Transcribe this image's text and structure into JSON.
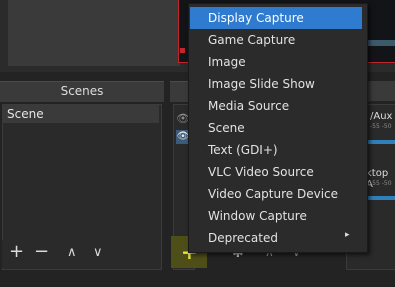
{
  "scenes": {
    "title": "Scenes",
    "items": [
      "Scene"
    ],
    "toolbar": {
      "add": "+",
      "remove": "−",
      "up": "∧",
      "down": "∨"
    }
  },
  "sources": {
    "toolbar": {
      "add": "+",
      "settings": "✱",
      "up": "∧",
      "down": "∨"
    },
    "visibility_icon": "eye-icon"
  },
  "mixer": {
    "channels": [
      {
        "label": "/Aux",
        "scale": "-55  -50"
      },
      {
        "label": "ktop A",
        "scale": "-55  -50"
      }
    ]
  },
  "context_menu": {
    "items": [
      "Display Capture",
      "Game Capture",
      "Image",
      "Image Slide Show",
      "Media Source",
      "Scene",
      "Text (GDI+)",
      "VLC Video Source",
      "Video Capture Device",
      "Window Capture",
      "Deprecated"
    ],
    "selected": "Display Capture",
    "submenu_indicator": "▸"
  },
  "colors": {
    "accent": "#2f7bd0",
    "add_highlight": "#e8e83a",
    "frame_border": "#c0272d"
  }
}
